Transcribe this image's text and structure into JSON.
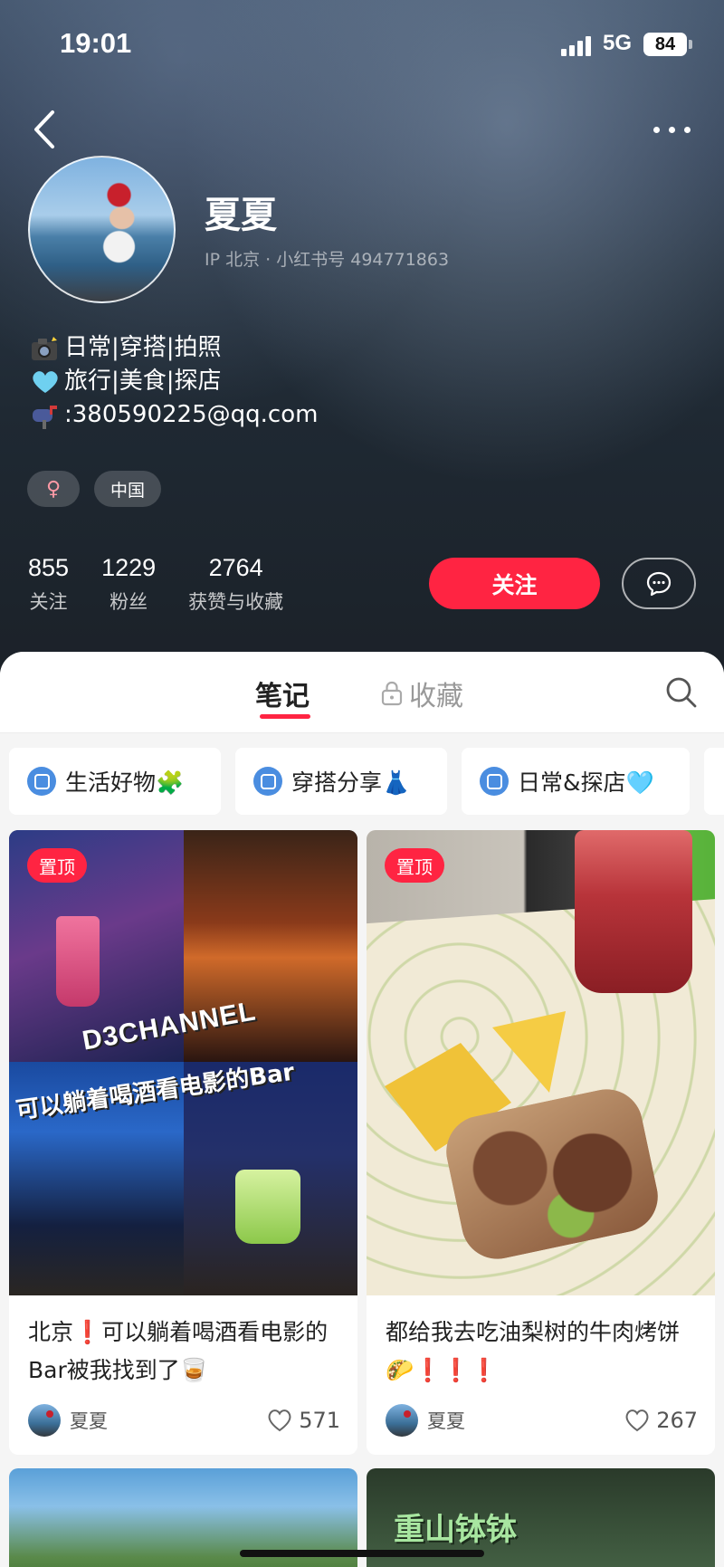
{
  "status_bar": {
    "time": "19:01",
    "network": "5G",
    "battery": "84"
  },
  "profile": {
    "nickname": "夏夏",
    "ip_line": "IP 北京 · 小红书号 494771863",
    "bio": [
      {
        "icon": "camera-flash-icon",
        "text": "日常|穿搭|拍照"
      },
      {
        "icon": "light-blue-heart-icon",
        "text": "旅行|美食|探店"
      },
      {
        "icon": "mailbox-icon",
        "text": ":380590225@qq.com"
      }
    ],
    "tags": {
      "gender": "♀",
      "region": "中国"
    },
    "stats": [
      {
        "value": "855",
        "label": "关注"
      },
      {
        "value": "1229",
        "label": "粉丝"
      },
      {
        "value": "2764",
        "label": "获赞与收藏"
      }
    ],
    "follow_label": "关注"
  },
  "tabs": {
    "notes": "笔记",
    "collections": "收藏"
  },
  "collections_chips": [
    "生活好物🧩",
    "穿搭分享👗",
    "日常&探店🩵"
  ],
  "notes": [
    {
      "pinned": "置顶",
      "cover_text_1": "D3CHANNEL",
      "cover_text_2": "可以躺着喝酒看电影的Bar",
      "title": "北京❗️可以躺着喝酒看电影的Bar被我找到了🥃",
      "author": "夏夏",
      "likes": "571"
    },
    {
      "pinned": "置顶",
      "title": "都给我去吃油梨树的牛肉烤饼🌮❗️❗️❗️",
      "author": "夏夏",
      "likes": "267"
    },
    {
      "cover_text": ""
    },
    {
      "cover_text": "重山钵钵"
    }
  ],
  "colors": {
    "accent": "#ff2442",
    "chip_icon": "#4a8de0"
  }
}
